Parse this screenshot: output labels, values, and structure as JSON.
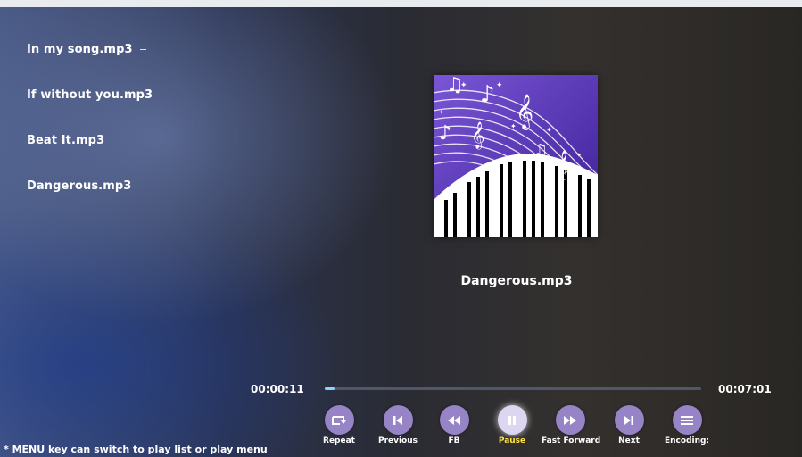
{
  "playlist": {
    "items": [
      {
        "label": "In my song.mp3"
      },
      {
        "label": "If without you.mp3"
      },
      {
        "label": "Beat It.mp3"
      },
      {
        "label": "Dangerous.mp3"
      }
    ]
  },
  "now_playing": {
    "title": "Dangerous.mp3",
    "current_time": "00:00:11",
    "total_time": "00:07:01",
    "progress_fraction": 0.026
  },
  "controls": [
    {
      "label": "Repeat",
      "icon": "repeat-icon",
      "active": false
    },
    {
      "label": "Previous",
      "icon": "skip-previous-icon",
      "active": false
    },
    {
      "label": "FB",
      "icon": "fast-backward-icon",
      "active": false
    },
    {
      "label": "Pause",
      "icon": "pause-icon",
      "active": true
    },
    {
      "label": "Fast Forward",
      "icon": "fast-forward-icon",
      "active": false
    },
    {
      "label": "Next",
      "icon": "skip-next-icon",
      "active": false
    },
    {
      "label": "Encoding:",
      "icon": "encoding-icon",
      "active": false
    }
  ],
  "hint": "* MENU key can switch to play list or play menu",
  "colors": {
    "button": "#9684c6",
    "button_active": "#dcd6f1",
    "active_label": "#ffe23a",
    "progress": "#8bd3ff",
    "album_bg": "#5a37b8"
  }
}
